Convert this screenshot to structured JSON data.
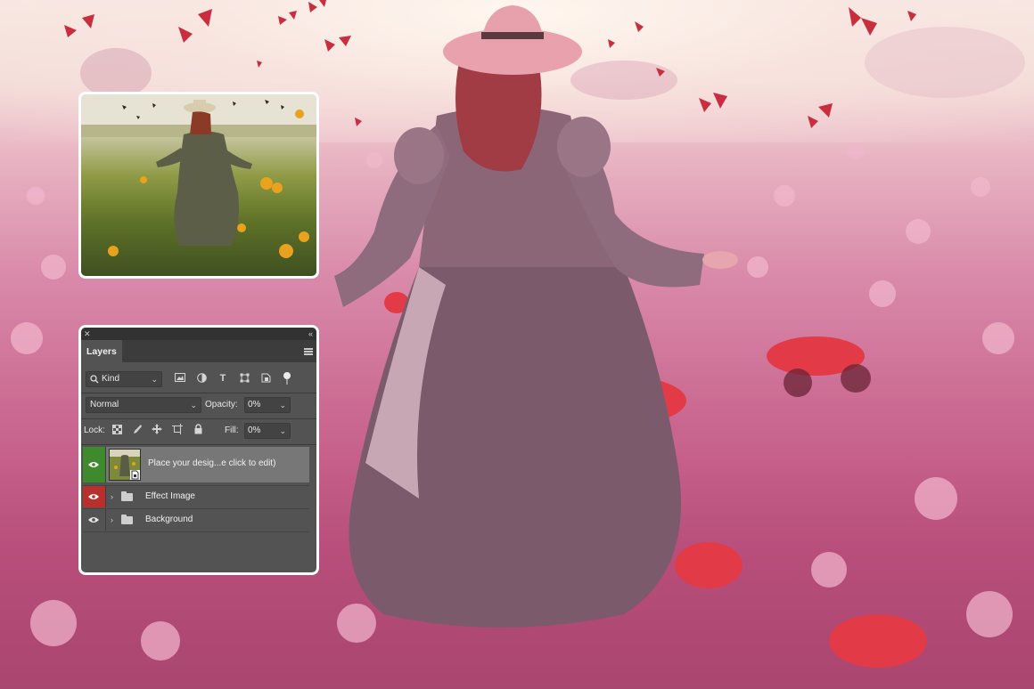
{
  "panel": {
    "title_tab": "Layers",
    "filter": {
      "kind_label": "Kind",
      "icons": [
        "image-filter-icon",
        "adjustment-filter-icon",
        "type-filter-icon",
        "shape-filter-icon",
        "smart-object-filter-icon",
        "toggle-filter-icon"
      ]
    },
    "blend": {
      "mode": "Normal",
      "opacity_label": "Opacity:",
      "opacity_value": "0%"
    },
    "lock": {
      "label": "Lock:",
      "icons": [
        "lock-transparent-icon",
        "lock-image-icon",
        "lock-position-icon",
        "lock-artboard-icon",
        "lock-all-icon"
      ],
      "fill_label": "Fill:",
      "fill_value": "0%"
    },
    "layers": [
      {
        "name": "Place your desig...e click to edit)",
        "visible": true,
        "eye_color": "#3f8a2c",
        "type": "smart-object",
        "selected": true
      },
      {
        "name": "Effect Image",
        "visible": true,
        "eye_color": "#b8302b",
        "type": "group",
        "selected": false
      },
      {
        "name": "Background",
        "visible": true,
        "eye_color": "",
        "type": "group",
        "selected": false
      }
    ]
  },
  "colors": {
    "panel_bg": "#535353",
    "panel_dark": "#323232",
    "selected_layer": "#777777",
    "border": "#ffffff"
  }
}
